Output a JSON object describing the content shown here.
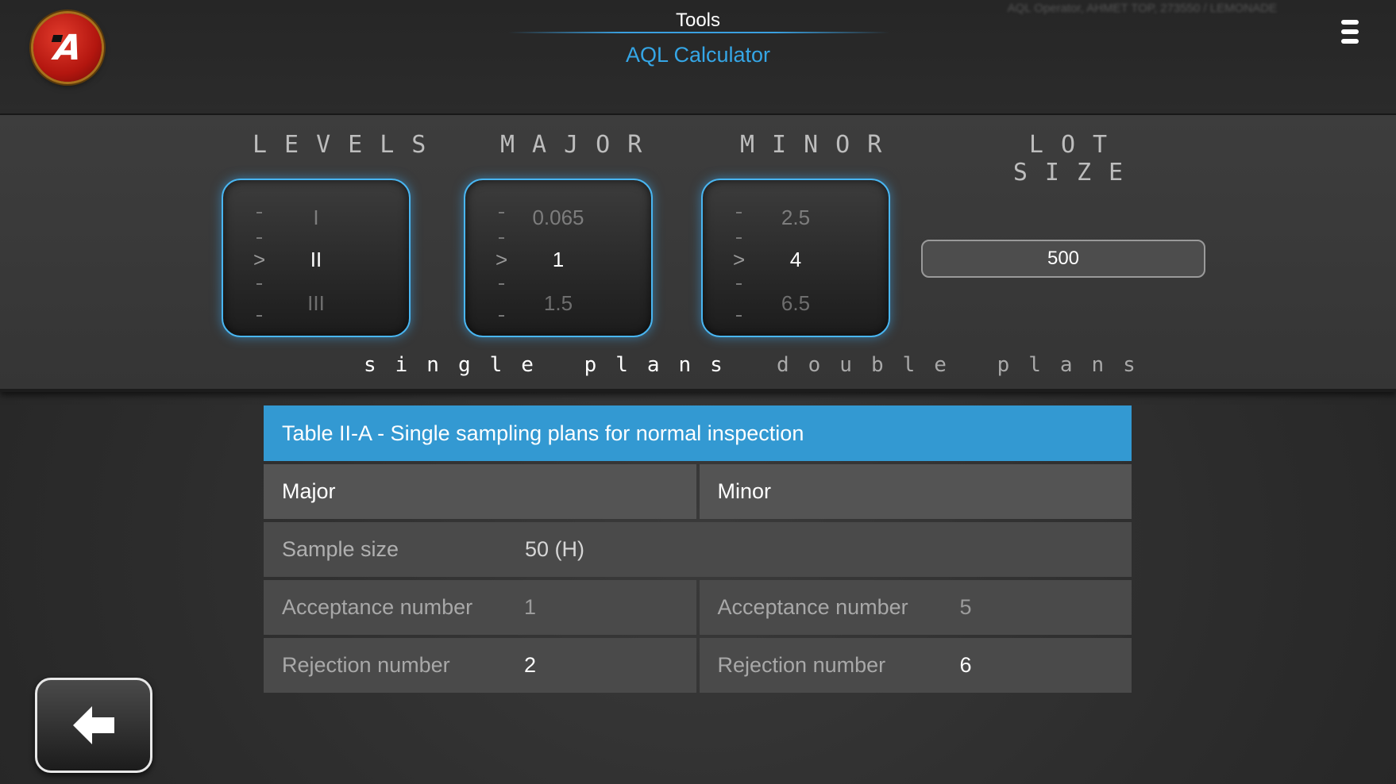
{
  "header": {
    "section_title": "Tools",
    "app_title": "AQL Calculator",
    "user_info": "AQL Operator, AHMET TOP, 273550 / LEMONADE"
  },
  "logo": {
    "text": "A"
  },
  "selectors": {
    "levels": {
      "label": "LEVELS",
      "prev": "I",
      "current": "II",
      "next": "III"
    },
    "major": {
      "label": "MAJOR",
      "prev": "0.065",
      "current": "1",
      "next": "1.5"
    },
    "minor": {
      "label": "MINOR",
      "prev": "2.5",
      "current": "4",
      "next": "6.5"
    },
    "lot_size": {
      "label": "LOT SIZE",
      "value": "500"
    }
  },
  "plans": {
    "single": "single plans",
    "double": "double plans",
    "active": "single"
  },
  "table": {
    "title": "Table II-A - Single sampling plans for normal inspection",
    "major_header": "Major",
    "minor_header": "Minor",
    "sample_size_label": "Sample size",
    "sample_size_value": "50 (H)",
    "major_acceptance_label": "Acceptance number",
    "major_acceptance_value": "1",
    "minor_acceptance_label": "Acceptance number",
    "minor_acceptance_value": "5",
    "major_rejection_label": "Rejection number",
    "major_rejection_value": "2",
    "minor_rejection_label": "Rejection number",
    "minor_rejection_value": "6"
  },
  "colors": {
    "accent": "#3399d2",
    "title_blue": "#35a6e6",
    "logo_red": "#c51a10"
  },
  "icons": {
    "menu": "hamburger-menu-icon",
    "back": "arrow-left-icon"
  }
}
